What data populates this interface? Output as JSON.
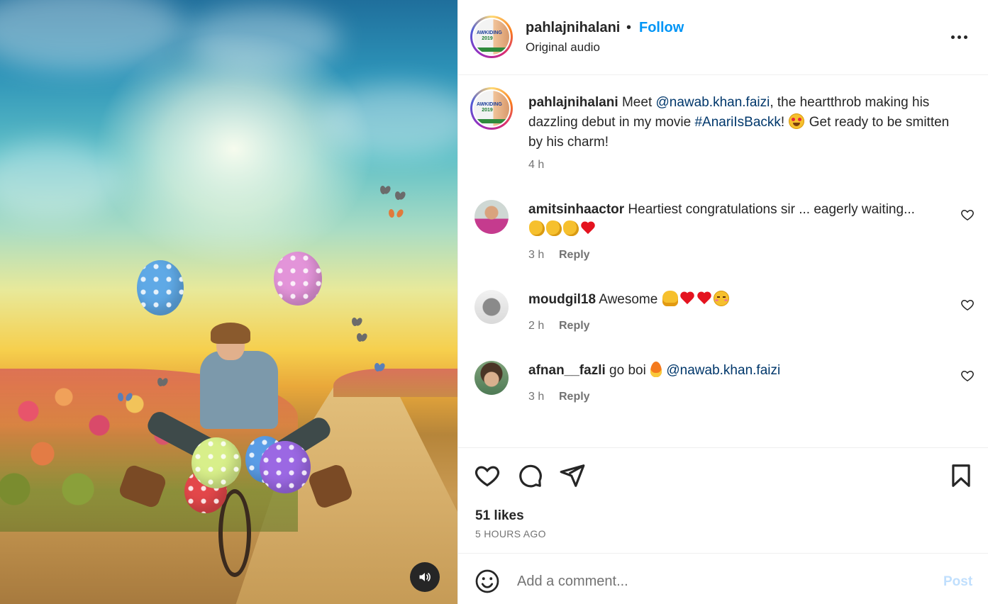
{
  "post": {
    "username": "pahlajnihalani",
    "follow_label": "Follow",
    "dot": "•",
    "audio": "Original audio",
    "avatar_text_line1": "AWKIDING",
    "avatar_text_line2": "2019",
    "more_icon": "more-horizontal-icon"
  },
  "caption": {
    "username": "pahlajnihalani",
    "text_before_mention": " Meet ",
    "mention": "@nawab.khan.faizi",
    "text_after_mention": ", the heartthrob making his dazzling debut in my movie ",
    "hashtag": "#AnariIsBackk",
    "text_after_hashtag": "! ",
    "text_end": " Get ready to be smitten by his charm!",
    "time": "4 h"
  },
  "comments": [
    {
      "username": "amitsinhaactor",
      "text": " Heartiest congratulations sir ... eagerly waiting...",
      "time": "3 h",
      "reply_label": "Reply"
    },
    {
      "username": "moudgil18",
      "text": " Awesome ",
      "time": "2 h",
      "reply_label": "Reply"
    },
    {
      "username": "afnan__fazli",
      "text": " go boi ",
      "mention": "@nawab.khan.faizi",
      "time": "3 h",
      "reply_label": "Reply"
    }
  ],
  "actions": {
    "likes": "51 likes",
    "posted_ago": "5 HOURS AGO"
  },
  "add_comment": {
    "placeholder": "Add a comment...",
    "post_label": "Post"
  },
  "colors": {
    "accent": "#0095f6",
    "link": "#00376b",
    "muted": "#737373",
    "post_disabled": "#c0dffd"
  }
}
